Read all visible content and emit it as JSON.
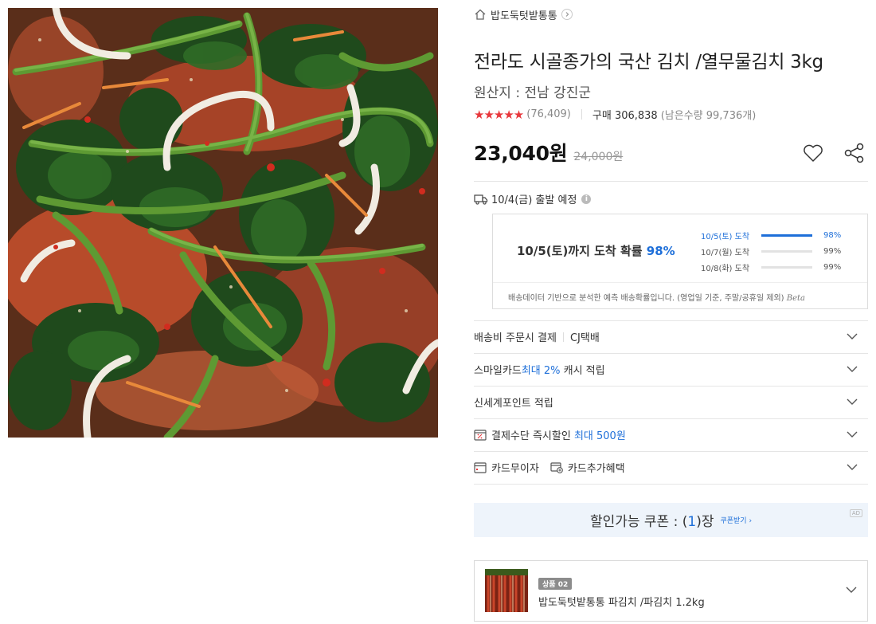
{
  "product": {
    "image_alt": "열무물김치 상품 이미지",
    "store_name": "밥도둑텃밭통통",
    "title": "전라도 시골종가의 국산 김치 /열무물김치 3kg",
    "origin": "원산지 : 전남 강진군",
    "stars": "★★★★★",
    "review_count": "(76,409)",
    "purchase": "구매 306,838",
    "remaining": "(남은수량 99,736개)",
    "price": "23,040원",
    "original_price": "24,000원"
  },
  "shipping": {
    "departure": "10/4(금) 출발 예정",
    "info_icon": "i",
    "arrival_main_prefix": "10/5(토)까지 도착 확률 ",
    "arrival_main_pct": "98%",
    "probabilities": [
      {
        "label": "10/5(토) 도착",
        "value": "98%",
        "fraction": 1.0
      },
      {
        "label": "10/7(월) 도착",
        "value": "99%",
        "fraction": 0
      },
      {
        "label": "10/8(화) 도착",
        "value": "99%",
        "fraction": 0
      }
    ],
    "note": "배송데이터 기반으로 분석한 예측 배송확률입니다. (영업일 기준, 주말/공휴일 제외) ",
    "beta": "Beta"
  },
  "benefits": {
    "delivery_fee": "배송비 주문시 결제",
    "courier": "CJ택배",
    "smile_prefix": "스마일카드 ",
    "smile_highlight": "최대 2%",
    "smile_suffix": " 캐시 적립",
    "shinsegae": "신세계포인트 적립",
    "payment_prefix": "결제수단 즉시할인 ",
    "payment_highlight": "최대 500원",
    "card_interest_free": "카드무이자",
    "card_extra": "카드추가혜택"
  },
  "coupon": {
    "prefix": "할인가능 쿠폰 : (",
    "count": "1",
    "suffix": ")장",
    "link": "쿠폰받기 ›",
    "ad": "AD"
  },
  "related": {
    "badge": "상품 02",
    "name": "밥도둑텃밭통통 파김치 /파김치 1.2kg"
  },
  "colors": {
    "accent": "#1e6fd9",
    "star": "#e8383d",
    "coupon_bg": "#eef4fb"
  },
  "icons": [
    "home-icon",
    "chevron-right-icon",
    "heart-icon",
    "share-icon",
    "truck-icon",
    "info-icon",
    "chevron-down-icon",
    "percent-card-icon",
    "card-icon",
    "card-plus-icon"
  ]
}
